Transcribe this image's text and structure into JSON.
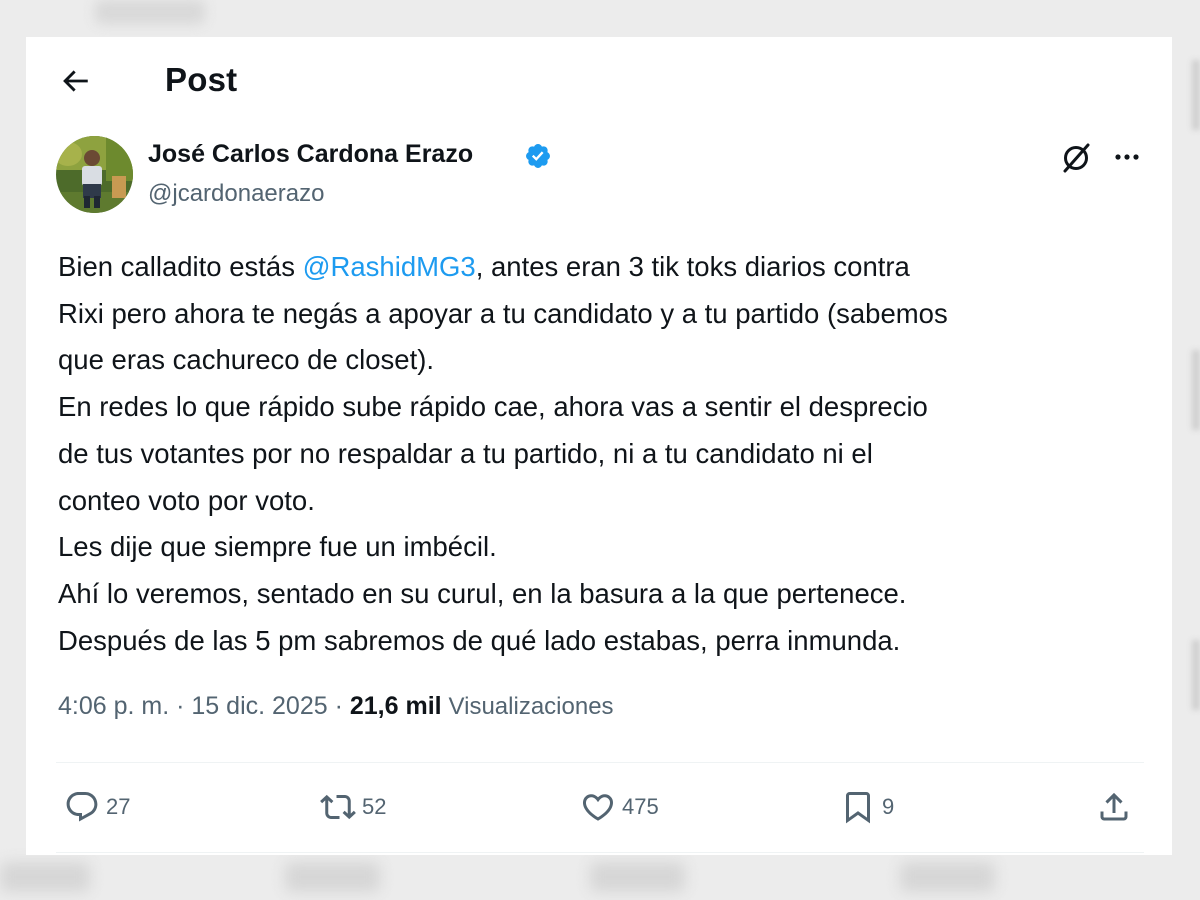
{
  "header": {
    "title": "Post"
  },
  "author": {
    "name": "José Carlos Cardona Erazo",
    "handle": "@jcardonaerazo",
    "verified": true
  },
  "tweet": {
    "lines": [
      {
        "before": "Bien calladito estás ",
        "mention": "@RashidMG3",
        "after": ", antes eran 3 tik toks diarios contra"
      },
      "Rixi pero ahora te negás a apoyar a tu candidato y a tu partido (sabemos",
      "que eras cachureco de closet).",
      "En redes lo que rápido sube rápido cae, ahora vas a sentir el desprecio",
      "de tus votantes por no respaldar a tu partido, ni a tu candidato ni el",
      "conteo voto por voto.",
      "Les dije que siempre fue un imbécil.",
      "Ahí lo veremos, sentado en su curul, en la basura a la que pertenece.",
      "Después de las 5 pm sabremos de qué lado estabas, perra inmunda."
    ]
  },
  "meta": {
    "time": "4:06 p. m.",
    "separator": "·",
    "date": "15 dic. 2025",
    "views_count": "21,6 mil",
    "views_label": "Visualizaciones"
  },
  "actions": {
    "replies": "27",
    "reposts": "52",
    "likes": "475",
    "bookmarks": "9"
  },
  "colors": {
    "accent": "#1d9bf0",
    "text": "#0f1419",
    "muted": "#536471"
  }
}
